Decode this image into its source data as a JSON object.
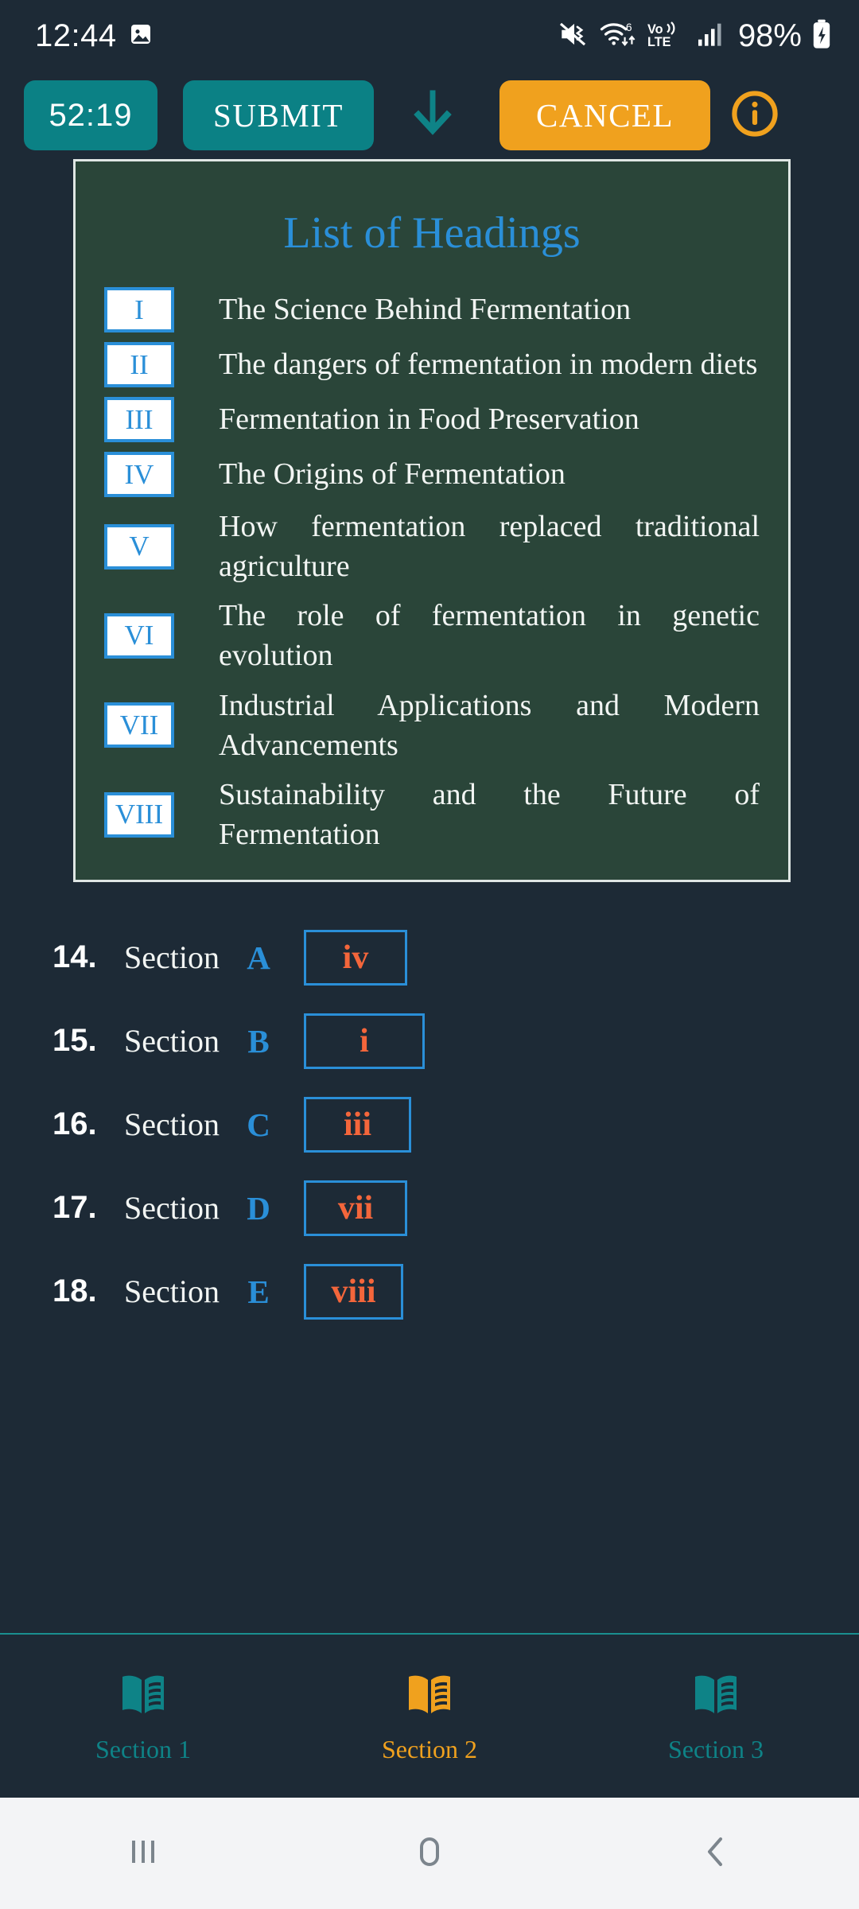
{
  "status_bar": {
    "time": "12:44",
    "battery_percent": "98%",
    "icons": [
      "image-icon",
      "mute-icon",
      "wifi6-icon",
      "volte-icon",
      "signal-bars-icon",
      "battery-charging-icon"
    ],
    "network_label": "Vo))",
    "network_label2": "LTE",
    "wifi_gen": "6"
  },
  "toolbar": {
    "timer": "52:19",
    "submit_label": "SUBMIT",
    "cancel_label": "CANCEL",
    "scroll_down_icon": "arrow-down-icon",
    "info_icon": "info-circle-icon",
    "colors": {
      "teal": "#0b8185",
      "orange": "#f0a11e",
      "background": "#1d2a36"
    }
  },
  "headings_panel": {
    "title": "List of Headings",
    "title_color": "#2a8fd8",
    "panel_background": "#2a4539",
    "items": [
      {
        "numeral": "I",
        "text": "The Science Behind Fermentation"
      },
      {
        "numeral": "II",
        "text": "The dangers of fermentation in modern diets"
      },
      {
        "numeral": "III",
        "text": "Fermentation in Food Preservation"
      },
      {
        "numeral": "IV",
        "text": "The Origins of Fermentation"
      },
      {
        "numeral": "V",
        "text": "How fermentation replaced traditional agriculture"
      },
      {
        "numeral": "VI",
        "text": "The role of fermentation in genetic evolution"
      },
      {
        "numeral": "VII",
        "text": "Industrial Applications and Modern Advancements"
      },
      {
        "numeral": "VIII",
        "text": "Sustainability and the Future of Fermentation"
      }
    ]
  },
  "questions": {
    "label_word": "Section",
    "rows": [
      {
        "number": "14.",
        "label": "Section",
        "letter": "A",
        "answer": "iv"
      },
      {
        "number": "15.",
        "label": "Section",
        "letter": "B",
        "answer": "i"
      },
      {
        "number": "16.",
        "label": "Section",
        "letter": "C",
        "answer": "iii"
      },
      {
        "number": "17.",
        "label": "Section",
        "letter": "D",
        "answer": "vii"
      },
      {
        "number": "18.",
        "label": "Section",
        "letter": "E",
        "answer": "viii"
      }
    ],
    "answer_color": "#f4663b",
    "letter_color": "#2a8fd8"
  },
  "bottom_nav": {
    "items": [
      {
        "label": "Section 1",
        "icon": "book-icon",
        "active": false
      },
      {
        "label": "Section 2",
        "icon": "book-icon",
        "active": true
      },
      {
        "label": "Section 3",
        "icon": "book-icon",
        "active": false
      }
    ],
    "active_color": "#f0a11e",
    "inactive_color": "#0e8387"
  },
  "android_nav": {
    "recents_icon": "recents-icon",
    "home_icon": "home-icon",
    "back_icon": "back-icon"
  }
}
